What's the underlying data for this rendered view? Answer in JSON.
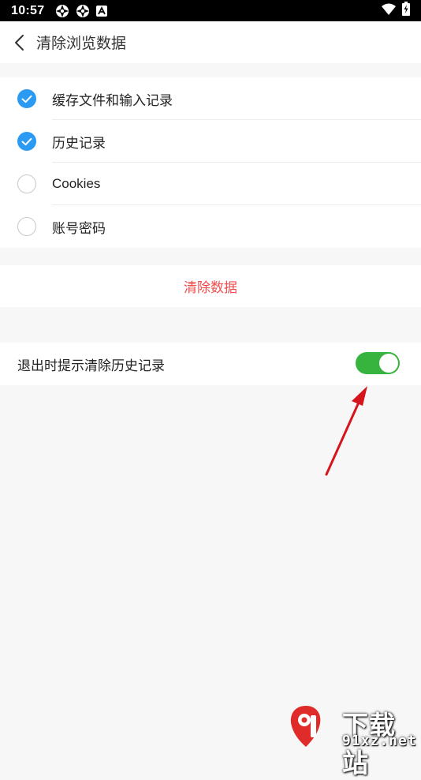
{
  "status_bar": {
    "time": "10:57",
    "notification_icons": [
      "aperture-icon",
      "aperture-icon",
      "a-letter-icon"
    ],
    "right_icons": [
      "wifi-icon",
      "battery-charging-icon"
    ]
  },
  "header": {
    "back_icon": "chevron-left-icon",
    "title": "清除浏览数据"
  },
  "options": [
    {
      "label": "缓存文件和输入记录",
      "checked": true
    },
    {
      "label": "历史记录",
      "checked": true
    },
    {
      "label": "Cookies",
      "checked": false
    },
    {
      "label": "账号密码",
      "checked": false
    }
  ],
  "clear_button": {
    "label": "清除数据",
    "color": "#f04d4d"
  },
  "exit_prompt": {
    "label": "退出时提示清除历史记录",
    "enabled": true,
    "toggle_color": "#36b43d"
  },
  "colors": {
    "accent": "#2b9af3",
    "background": "#f7f7f7",
    "annotation_arrow": "#d6141c"
  },
  "watermark": {
    "title": "下载站",
    "domain": "91xz.net",
    "logo_text": "91"
  }
}
